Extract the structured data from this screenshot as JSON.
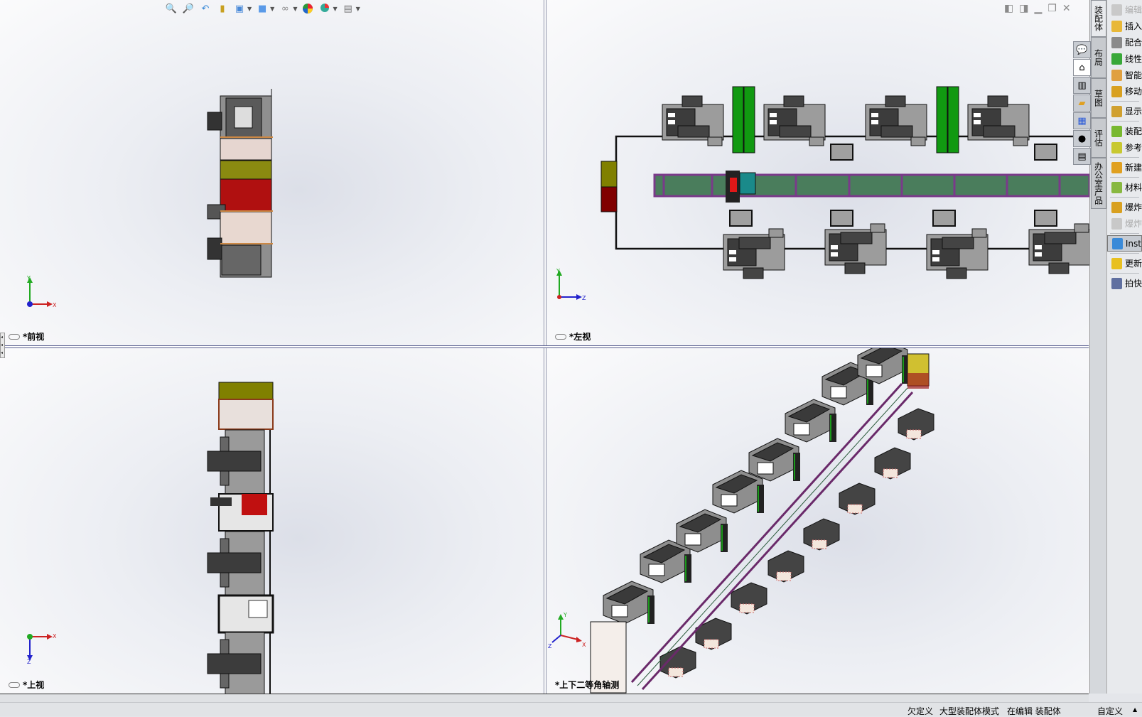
{
  "toolbar": {
    "icons": [
      "zoom-to-fit-icon",
      "zoom-to-area-icon",
      "previous-view-icon",
      "section-view-icon",
      "view-orientation-icon",
      "display-style-icon",
      "hide-show-items-icon",
      "edit-appearance-icon",
      "apply-scene-icon",
      "view-settings-icon"
    ]
  },
  "viewports": {
    "front": {
      "label": "*前视",
      "axes": [
        "Y",
        "X"
      ]
    },
    "left": {
      "label": "*左视",
      "axes": [
        "Y",
        "Z"
      ]
    },
    "top": {
      "label": "*上视",
      "axes": [
        "X",
        "Z"
      ]
    },
    "dimetric": {
      "label": "*上下二等角轴测",
      "axes": [
        "Y",
        "X",
        "Z"
      ]
    }
  },
  "vertical_tabs": [
    "装配体",
    "布局",
    "草图",
    "评估",
    "办公室产品"
  ],
  "command_panel": [
    {
      "label": "编辑",
      "color": "#c9c9c9",
      "disabled": true
    },
    {
      "label": "插入",
      "color": "#e8b838"
    },
    {
      "label": "配合",
      "color": "#8a8a8a"
    },
    {
      "label": "线性",
      "color": "#38a838"
    },
    {
      "label": "智能",
      "color": "#e0a040"
    },
    {
      "label": "移动",
      "color": "#d8a020"
    },
    {
      "label": "显示",
      "color": "#d0a030",
      "sep_before": true
    },
    {
      "label": "装配",
      "color": "#78b830",
      "sep_before": true
    },
    {
      "label": "参考",
      "color": "#c8c830"
    },
    {
      "label": "新建",
      "color": "#e0a020",
      "sep_before": true
    },
    {
      "label": "材料",
      "color": "#88b840",
      "sep_before": true
    },
    {
      "label": "爆炸",
      "color": "#d8a020",
      "sep_before": true
    },
    {
      "label": "爆炸",
      "color": "#c8c8c8",
      "disabled": true
    },
    {
      "label": "Inst",
      "color": "#3a8ad8",
      "sep_before": true,
      "active": true
    },
    {
      "label": "更新",
      "color": "#e8c020",
      "sep_before": true
    },
    {
      "label": "拍快",
      "color": "#6070a0",
      "sep_before": true
    }
  ],
  "task_pane": [
    "solidworks-resources-icon",
    "home-icon",
    "design-library-icon",
    "file-explorer-icon",
    "view-palette-icon",
    "appearances-icon",
    "custom-properties-icon"
  ],
  "status_bar": {
    "state": "欠定义",
    "mode": "大型装配体模式",
    "editing": "在编辑 装配体",
    "units": "自定义"
  }
}
